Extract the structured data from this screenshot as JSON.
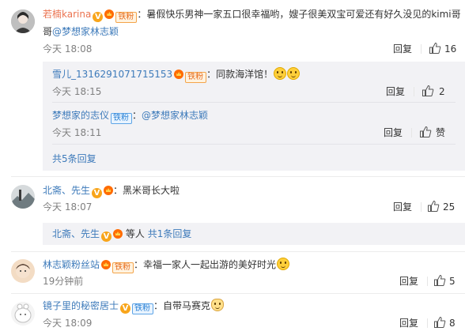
{
  "comments": [
    {
      "author": "若楠karina",
      "fan_badge": "铁粉",
      "text": "：暑假快乐男神一家五口很幸福哟，嫂子很美双宝可爱还有好久没见的kimi哥",
      "text2_prefix": "哥",
      "mention": "@梦想家林志颖",
      "time": "今天 18:08",
      "reply_label": "回复",
      "likes": "16"
    },
    {
      "author": "北斋、先生",
      "text": "：黑米哥长大啦",
      "time": "今天 18:07",
      "reply_label": "回复",
      "likes": "25"
    },
    {
      "author": "林志颖粉丝站",
      "fan_badge": "铁粉",
      "text": "：幸福一家人一起出游的美好时光",
      "time": "19分钟前",
      "reply_label": "回复",
      "likes": "5"
    },
    {
      "author": "镜子里的秘密居士",
      "fan_badge": "铁粉",
      "text": "：自带马赛克",
      "time": "今天 18:09",
      "reply_label": "回复",
      "likes": "8"
    }
  ],
  "replies": [
    {
      "author": "雪儿_1316291071715153",
      "fan_badge": "铁粉",
      "text": "：同款海洋馆！",
      "time": "今天 18:15",
      "reply_label": "回复",
      "likes": "2"
    },
    {
      "author": "梦想家的志仪",
      "fan_badge": "铁粉",
      "text_sep": "：",
      "mention": "@梦想家林志颖",
      "time": "今天 18:11",
      "reply_label": "回复",
      "likes": "赞"
    }
  ],
  "more_replies_1": "共5条回复",
  "collapsed_reply": {
    "author": "北斋、先生",
    "etc": "等人",
    "count": "共1条回复"
  },
  "colors": {
    "name_orange": "#eb7350",
    "link_blue": "#3d7aba",
    "reply_bg": "#f2f2f5"
  }
}
